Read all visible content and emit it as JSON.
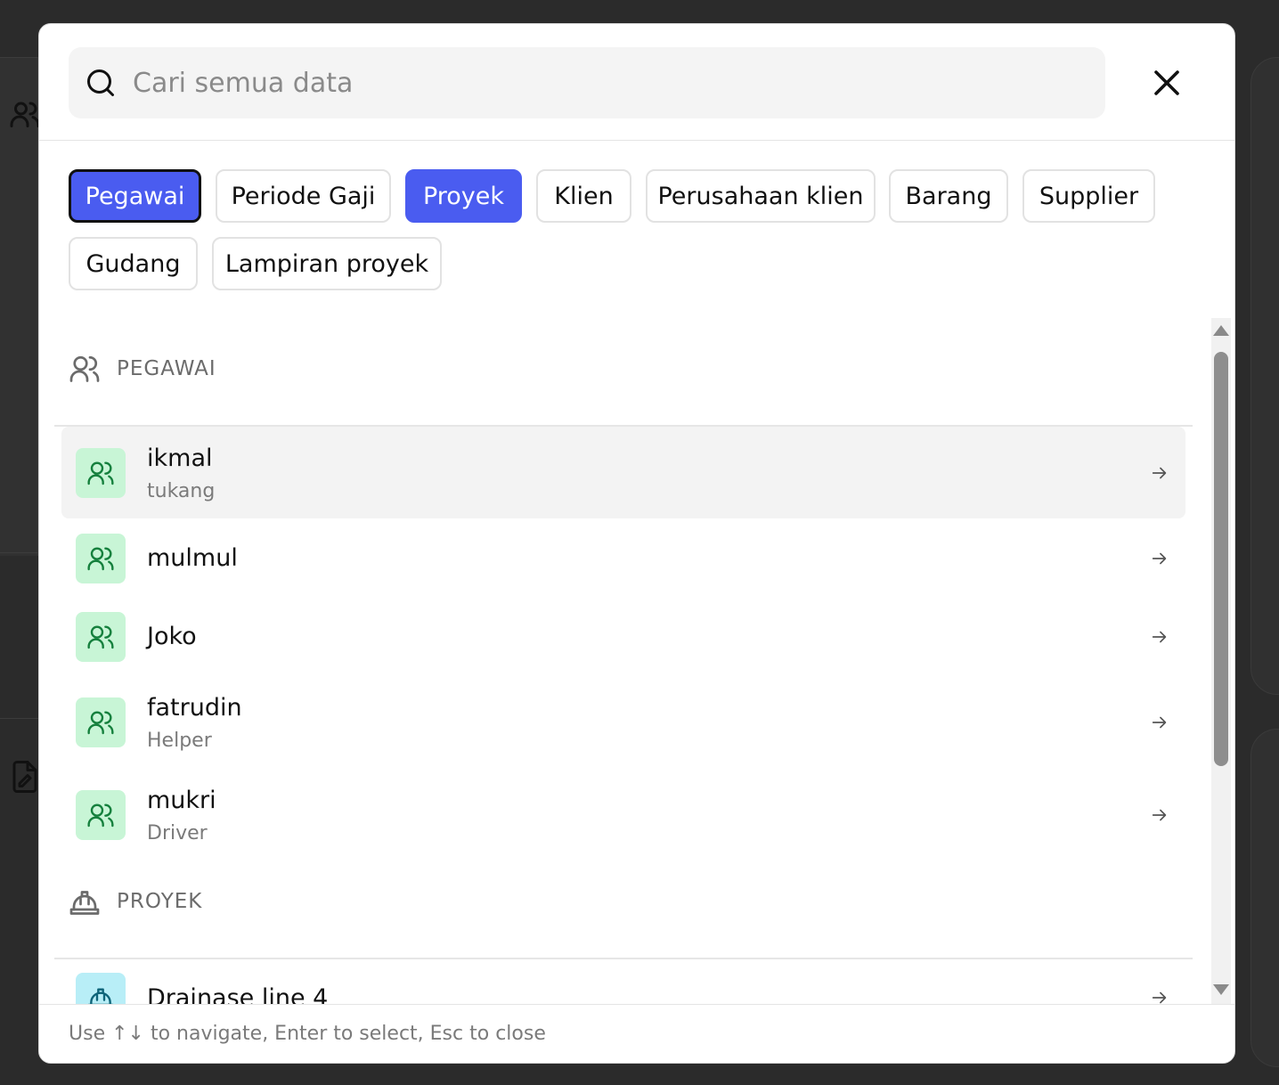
{
  "search": {
    "placeholder": "Cari semua data",
    "value": ""
  },
  "filters": [
    {
      "label": "Pegawai",
      "active": true
    },
    {
      "label": "Periode Gaji",
      "active": false
    },
    {
      "label": "Proyek",
      "active": true
    },
    {
      "label": "Klien",
      "active": false
    },
    {
      "label": "Perusahaan klien",
      "active": false
    },
    {
      "label": "Barang",
      "active": false
    },
    {
      "label": "Supplier",
      "active": false
    },
    {
      "label": "Gudang",
      "active": false
    },
    {
      "label": "Lampiran proyek",
      "active": false
    }
  ],
  "sections": {
    "pegawai": {
      "label": "PEGAWAI",
      "icon": "users-icon",
      "items": [
        {
          "name": "ikmal",
          "role": "tukang"
        },
        {
          "name": "mulmul",
          "role": ""
        },
        {
          "name": "Joko",
          "role": ""
        },
        {
          "name": "fatrudin",
          "role": "Helper"
        },
        {
          "name": "mukri",
          "role": "Driver"
        }
      ]
    },
    "proyek": {
      "label": "PROYEK",
      "icon": "hard-hat-icon",
      "items": [
        {
          "name": "Drainase line 4",
          "role": ""
        }
      ]
    }
  },
  "footer": {
    "hint": "Use ↑↓ to navigate, Enter to select, Esc to close"
  },
  "colors": {
    "accent": "#4a5cf0",
    "pegawai_badge": "#c8f5d6",
    "proyek_badge": "#b8eef7"
  }
}
